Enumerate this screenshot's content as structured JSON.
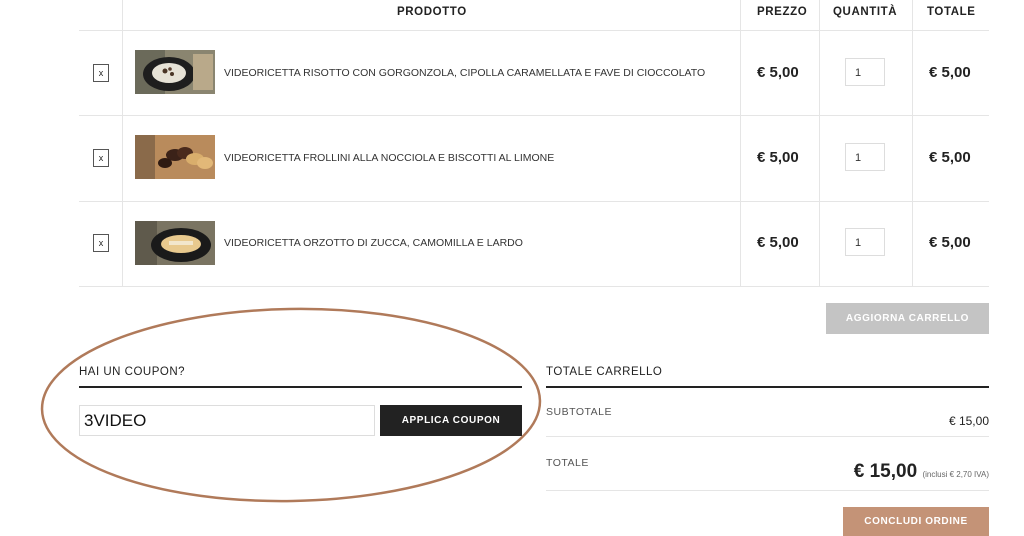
{
  "table": {
    "headers": {
      "product": "PRODOTTO",
      "price": "PREZZO",
      "quantity": "QUANTITÀ",
      "total": "TOTALE"
    },
    "rows": [
      {
        "remove": "x",
        "name": "VIDEORICETTA RISOTTO CON GORGONZOLA, CIPOLLA CARAMELLATA E FAVE DI CIOCCOLATO",
        "price": "€ 5,00",
        "qty": "1",
        "total": "€ 5,00"
      },
      {
        "remove": "x",
        "name": "VIDEORICETTA FROLLINI ALLA NOCCIOLA E BISCOTTI AL LIMONE",
        "price": "€ 5,00",
        "qty": "1",
        "total": "€ 5,00"
      },
      {
        "remove": "x",
        "name": "VIDEORICETTA ORZOTTO DI ZUCCA, CAMOMILLA E LARDO",
        "price": "€ 5,00",
        "qty": "1",
        "total": "€ 5,00"
      }
    ]
  },
  "update_button": "AGGIORNA CARRELLO",
  "coupon": {
    "title": "HAI UN COUPON?",
    "value": "3VIDEO",
    "apply_button": "APPLICA COUPON"
  },
  "totals": {
    "title": "TOTALE CARRELLO",
    "subtotal_label": "SUBTOTALE",
    "subtotal_value": "€ 15,00",
    "total_label": "TOTALE",
    "total_value": "€ 15,00",
    "tax_note": "(inclusi € 2,70 IVA)",
    "checkout_button": "CONCLUDI ORDINE"
  },
  "colors": {
    "accent": "#c49377",
    "dark": "#222222",
    "muted_button": "#c4c4c4",
    "annotation": "#b07a5a"
  }
}
